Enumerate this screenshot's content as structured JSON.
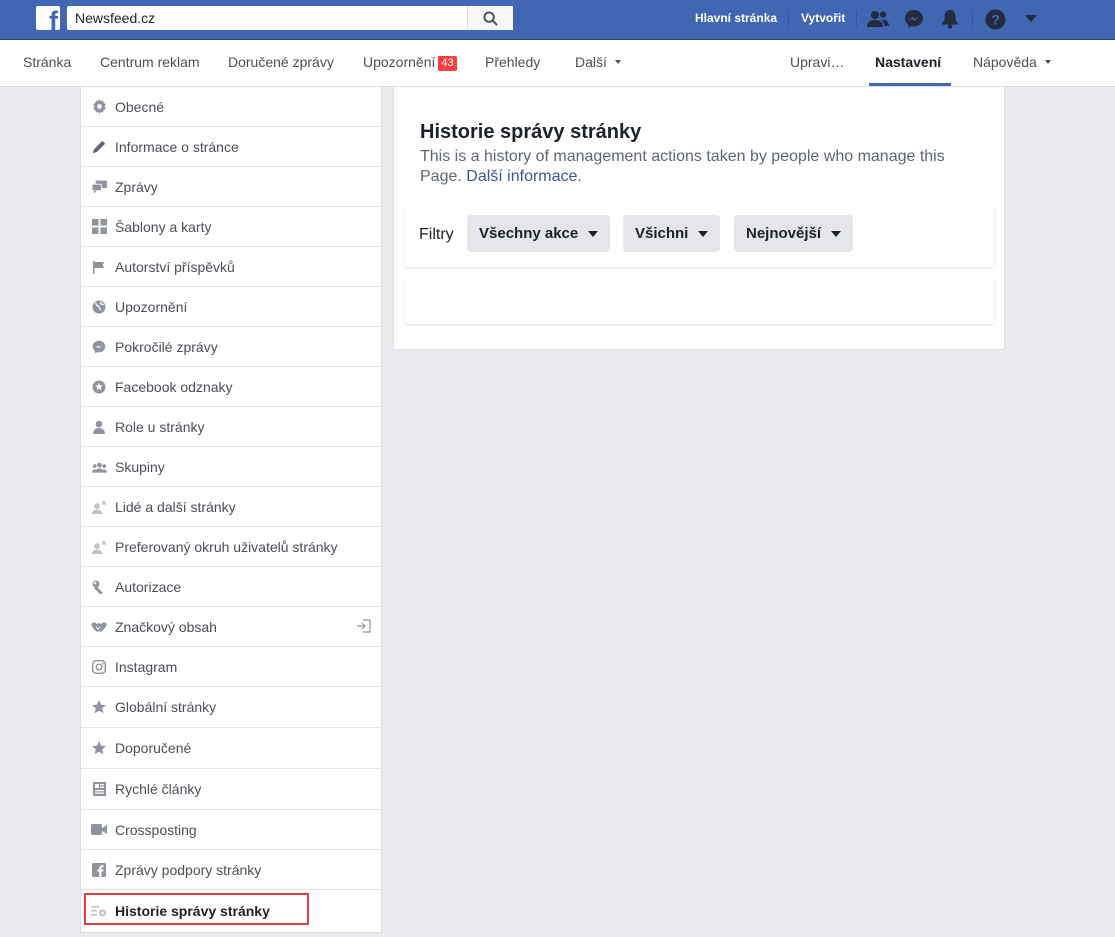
{
  "topbar": {
    "search_value": "Newsfeed.cz",
    "links": {
      "home": "Hlavní stránka",
      "create": "Vytvořit"
    }
  },
  "pagenav": {
    "items": [
      {
        "label": "Stránka"
      },
      {
        "label": "Centrum reklam"
      },
      {
        "label": "Doručené zprávy"
      },
      {
        "label": "Upozornění",
        "badge": "43"
      },
      {
        "label": "Přehledy"
      },
      {
        "label": "Další"
      }
    ],
    "right_items": [
      {
        "label": "Upravi…"
      },
      {
        "label": "Nastavení"
      },
      {
        "label": "Nápověda"
      }
    ],
    "active": "Nastavení"
  },
  "sidebar": {
    "items": [
      {
        "label": "Obecné",
        "icon": "gear-icon"
      },
      {
        "label": "Informace o stránce",
        "icon": "pencil-icon"
      },
      {
        "label": "Zprávy",
        "icon": "chat-bubbles-icon"
      },
      {
        "label": "Šablony a karty",
        "icon": "grid-icon"
      },
      {
        "label": "Autorství příspěvků",
        "icon": "flag-icon"
      },
      {
        "label": "Upozornění",
        "icon": "globe-icon"
      },
      {
        "label": "Pokročilé zprávy",
        "icon": "messenger-icon"
      },
      {
        "label": "Facebook odznaky",
        "icon": "badge-star-icon"
      },
      {
        "label": "Role u stránky",
        "icon": "person-icon"
      },
      {
        "label": "Skupiny",
        "icon": "group-icon"
      },
      {
        "label": "Lidé a další stránky",
        "icon": "person-star-icon"
      },
      {
        "label": "Preferovaný okruh uživatelů stránky",
        "icon": "person-star-icon"
      },
      {
        "label": "Autorizace",
        "icon": "wrench-icon"
      },
      {
        "label": "Značkový obsah",
        "icon": "handshake-icon"
      },
      {
        "label": "Instagram",
        "icon": "instagram-icon"
      },
      {
        "label": "Globální stránky",
        "icon": "star-icon"
      },
      {
        "label": "Doporučené",
        "icon": "star-icon"
      },
      {
        "label": "Rychlé články",
        "icon": "article-icon"
      },
      {
        "label": "Crossposting",
        "icon": "video-camera-icon"
      },
      {
        "label": "Zprávy podpory stránky",
        "icon": "facebook-icon"
      },
      {
        "label": "Historie správy stránky",
        "icon": "list-gear-icon",
        "selected": true
      }
    ]
  },
  "main": {
    "title": "Historie správy stránky",
    "description": "This is a history of management actions taken by people who manage this Page.",
    "learn_more": "Další informace",
    "filters": {
      "label": "Filtry",
      "action": "Všechny akce",
      "people": "Všichni",
      "order": "Nejnovější"
    }
  },
  "colors": {
    "brand": "#4267b2",
    "highlight": "#e33f3f",
    "badge": "#fa3e3e",
    "link": "#385898"
  }
}
